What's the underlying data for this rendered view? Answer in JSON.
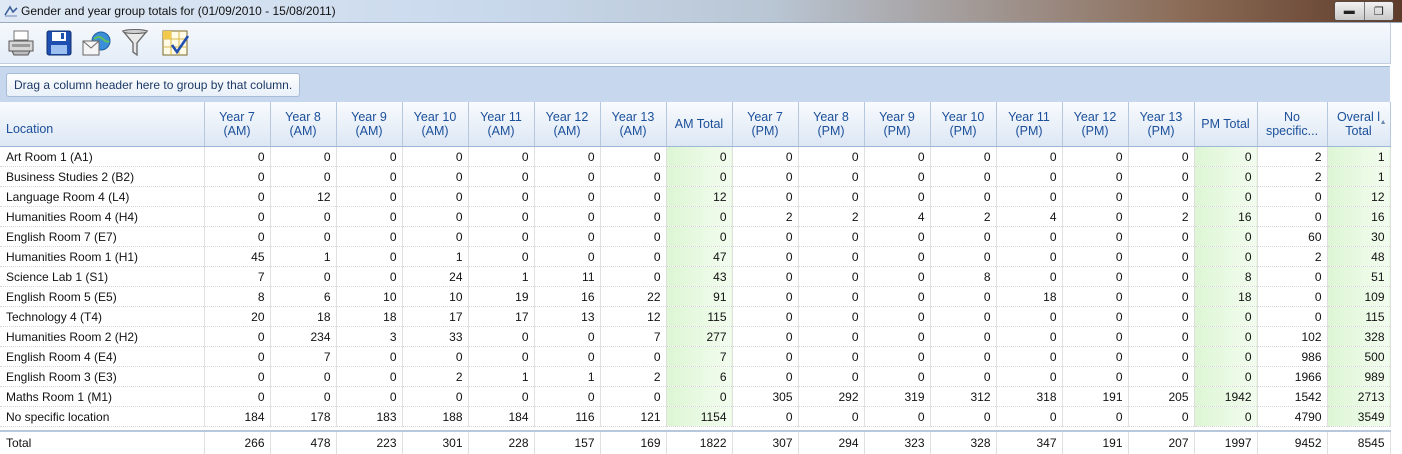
{
  "window": {
    "title": "Gender and year group totals for  (01/09/2010 - 15/08/2011)"
  },
  "toolbar": {
    "buttons": [
      {
        "name": "print-button",
        "icon": "printer-icon"
      },
      {
        "name": "save-button",
        "icon": "floppy-disk-icon"
      },
      {
        "name": "email-button",
        "icon": "envelope-globe-icon"
      },
      {
        "name": "filter-button",
        "icon": "funnel-icon"
      },
      {
        "name": "choose-columns-button",
        "icon": "grid-checkbox-icon"
      }
    ]
  },
  "group_panel": {
    "hint": "Drag a column header here to group by that column."
  },
  "colors": {
    "total_column_bg": "#e2f7da",
    "header_text": "#1b4f9a",
    "group_panel_bg": "#c6d7ee"
  },
  "grid": {
    "columns": [
      "Location",
      "Year  7 (AM)",
      "Year  8 (AM)",
      "Year  9 (AM)",
      "Year 10 (AM)",
      "Year 11 (AM)",
      "Year 12 (AM)",
      "Year 13 (AM)",
      "AM Total",
      "Year  7 (PM)",
      "Year  8 (PM)",
      "Year  9 (PM)",
      "Year 10 (PM)",
      "Year 11 (PM)",
      "Year 12 (PM)",
      "Year 13 (PM)",
      "PM Total",
      "No specific...",
      "Overal l Total"
    ],
    "rows": [
      [
        "Art Room 1 (A1)",
        "0",
        "0",
        "0",
        "0",
        "0",
        "0",
        "0",
        "0",
        "0",
        "0",
        "0",
        "0",
        "0",
        "0",
        "0",
        "0",
        "2",
        "1"
      ],
      [
        "Business Studies 2 (B2)",
        "0",
        "0",
        "0",
        "0",
        "0",
        "0",
        "0",
        "0",
        "0",
        "0",
        "0",
        "0",
        "0",
        "0",
        "0",
        "0",
        "2",
        "1"
      ],
      [
        "Language Room 4 (L4)",
        "0",
        "12",
        "0",
        "0",
        "0",
        "0",
        "0",
        "12",
        "0",
        "0",
        "0",
        "0",
        "0",
        "0",
        "0",
        "0",
        "0",
        "12"
      ],
      [
        "Humanities Room 4 (H4)",
        "0",
        "0",
        "0",
        "0",
        "0",
        "0",
        "0",
        "0",
        "2",
        "2",
        "4",
        "2",
        "4",
        "0",
        "2",
        "16",
        "0",
        "16"
      ],
      [
        "English Room 7 (E7)",
        "0",
        "0",
        "0",
        "0",
        "0",
        "0",
        "0",
        "0",
        "0",
        "0",
        "0",
        "0",
        "0",
        "0",
        "0",
        "0",
        "60",
        "30"
      ],
      [
        "Humanities Room 1 (H1)",
        "45",
        "1",
        "0",
        "1",
        "0",
        "0",
        "0",
        "47",
        "0",
        "0",
        "0",
        "0",
        "0",
        "0",
        "0",
        "0",
        "2",
        "48"
      ],
      [
        "Science Lab 1 (S1)",
        "7",
        "0",
        "0",
        "24",
        "1",
        "11",
        "0",
        "43",
        "0",
        "0",
        "0",
        "8",
        "0",
        "0",
        "0",
        "8",
        "0",
        "51"
      ],
      [
        "English Room 5 (E5)",
        "8",
        "6",
        "10",
        "10",
        "19",
        "16",
        "22",
        "91",
        "0",
        "0",
        "0",
        "0",
        "18",
        "0",
        "0",
        "18",
        "0",
        "109"
      ],
      [
        "Technology 4 (T4)",
        "20",
        "18",
        "18",
        "17",
        "17",
        "13",
        "12",
        "115",
        "0",
        "0",
        "0",
        "0",
        "0",
        "0",
        "0",
        "0",
        "0",
        "115"
      ],
      [
        "Humanities Room 2 (H2)",
        "0",
        "234",
        "3",
        "33",
        "0",
        "0",
        "7",
        "277",
        "0",
        "0",
        "0",
        "0",
        "0",
        "0",
        "0",
        "0",
        "102",
        "328"
      ],
      [
        "English Room 4 (E4)",
        "0",
        "7",
        "0",
        "0",
        "0",
        "0",
        "0",
        "7",
        "0",
        "0",
        "0",
        "0",
        "0",
        "0",
        "0",
        "0",
        "986",
        "500"
      ],
      [
        "English Room 3 (E3)",
        "0",
        "0",
        "0",
        "2",
        "1",
        "1",
        "2",
        "6",
        "0",
        "0",
        "0",
        "0",
        "0",
        "0",
        "0",
        "0",
        "1966",
        "989"
      ],
      [
        "Maths Room 1 (M1)",
        "0",
        "0",
        "0",
        "0",
        "0",
        "0",
        "0",
        "0",
        "305",
        "292",
        "319",
        "312",
        "318",
        "191",
        "205",
        "1942",
        "1542",
        "2713"
      ],
      [
        "No specific location",
        "184",
        "178",
        "183",
        "188",
        "184",
        "116",
        "121",
        "1154",
        "0",
        "0",
        "0",
        "0",
        "0",
        "0",
        "0",
        "0",
        "4790",
        "3549"
      ]
    ],
    "totals": [
      "Total",
      "266",
      "478",
      "223",
      "301",
      "228",
      "157",
      "169",
      "1822",
      "307",
      "294",
      "323",
      "328",
      "347",
      "191",
      "207",
      "1997",
      "9452",
      "8545"
    ]
  }
}
